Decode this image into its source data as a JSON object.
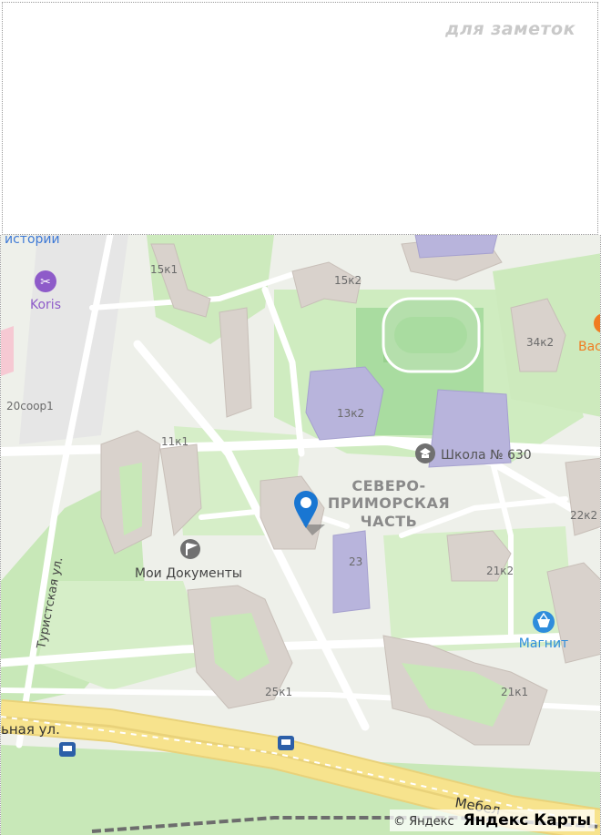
{
  "notes": {
    "label": "для заметок"
  },
  "map": {
    "district": [
      "СЕВЕРО-",
      "ПРИМОРСКАЯ",
      "ЧАСТЬ"
    ],
    "streets": {
      "turistskaya": "Туристская ул.",
      "left_street": "ьная ул.",
      "mebel": "Мебел"
    },
    "places": {
      "istorii": "истории",
      "koris": "Koris",
      "school": "Школа № 630",
      "docs": "Мои Документы",
      "magnit": "Магнит",
      "vas": "Вас"
    },
    "buildings": [
      "15к1",
      "15к2",
      "34к2",
      "20соор1",
      "13к2",
      "11к1",
      "22к2",
      "23",
      "21к2",
      "25к1",
      "21к1"
    ],
    "attribution": {
      "copyright": "© Яндекс",
      "brand": "Яндекс Карты"
    },
    "colors": {
      "green": "#c8e8b8",
      "road": "#ffffff",
      "building": "#d9d2cc",
      "school": "#b8b4dc",
      "highway": "#f7e38d",
      "accent": "#1976d2",
      "orange": "#f07c22"
    }
  }
}
